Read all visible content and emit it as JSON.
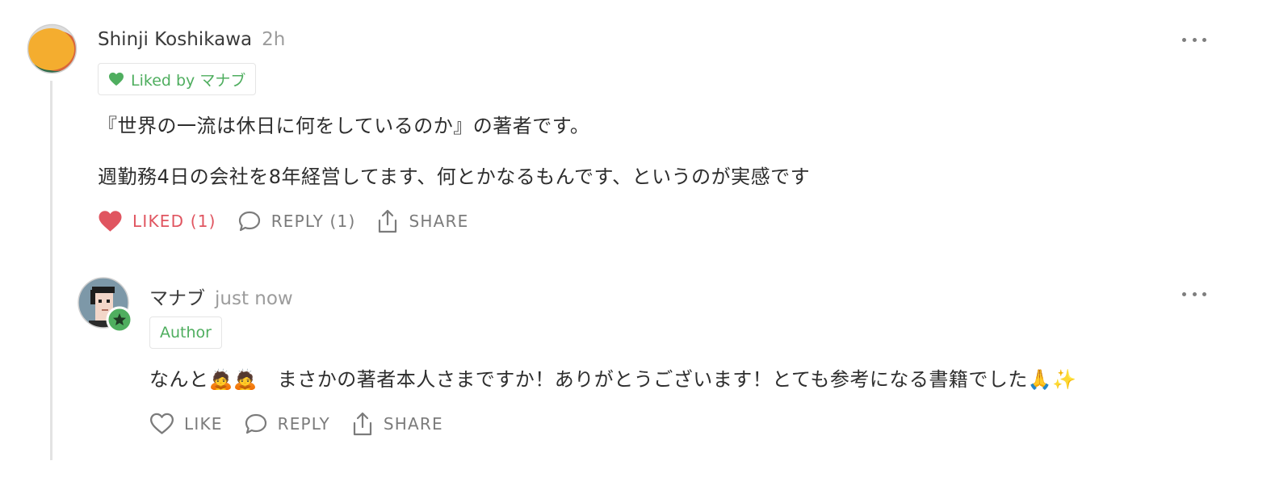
{
  "comment": {
    "author": "Shinji Koshikawa",
    "time": "2h",
    "liked_by": "Liked by マナブ",
    "body_line1": "『世界の一流は休日に何をしているのか』の著者です。",
    "body_line2": "週勤務4日の会社を8年経営してます、何とかなるもんです、というのが実感です",
    "actions": {
      "like_label": "LIKED (1)",
      "reply_label": "REPLY (1)",
      "share_label": "SHARE"
    }
  },
  "reply": {
    "author": "マナブ",
    "time": "just now",
    "author_badge": "Author",
    "body": "なんと🙇🙇　まさかの著者本人さまですか！ありがとうございます！とても参考になる書籍でした🙏✨",
    "actions": {
      "like_label": "LIKE",
      "reply_label": "REPLY",
      "share_label": "SHARE"
    }
  },
  "colors": {
    "liked": "#e05560",
    "badge_green": "#4fae5f",
    "muted": "#7b7b7b"
  }
}
